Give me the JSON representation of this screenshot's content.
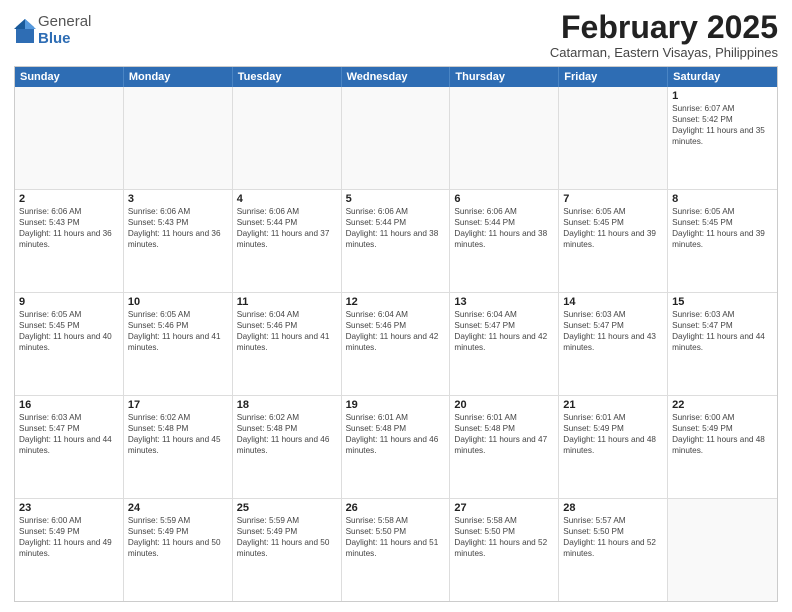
{
  "header": {
    "logo": {
      "general": "General",
      "blue": "Blue"
    },
    "title": "February 2025",
    "subtitle": "Catarman, Eastern Visayas, Philippines"
  },
  "calendar": {
    "days_of_week": [
      "Sunday",
      "Monday",
      "Tuesday",
      "Wednesday",
      "Thursday",
      "Friday",
      "Saturday"
    ],
    "weeks": [
      [
        {
          "day": "",
          "empty": true
        },
        {
          "day": "",
          "empty": true
        },
        {
          "day": "",
          "empty": true
        },
        {
          "day": "",
          "empty": true
        },
        {
          "day": "",
          "empty": true
        },
        {
          "day": "",
          "empty": true
        },
        {
          "day": "1",
          "sunrise": "6:07 AM",
          "sunset": "5:42 PM",
          "daylight": "11 hours and 35 minutes."
        }
      ],
      [
        {
          "day": "2",
          "sunrise": "6:06 AM",
          "sunset": "5:43 PM",
          "daylight": "11 hours and 36 minutes."
        },
        {
          "day": "3",
          "sunrise": "6:06 AM",
          "sunset": "5:43 PM",
          "daylight": "11 hours and 36 minutes."
        },
        {
          "day": "4",
          "sunrise": "6:06 AM",
          "sunset": "5:44 PM",
          "daylight": "11 hours and 37 minutes."
        },
        {
          "day": "5",
          "sunrise": "6:06 AM",
          "sunset": "5:44 PM",
          "daylight": "11 hours and 38 minutes."
        },
        {
          "day": "6",
          "sunrise": "6:06 AM",
          "sunset": "5:44 PM",
          "daylight": "11 hours and 38 minutes."
        },
        {
          "day": "7",
          "sunrise": "6:05 AM",
          "sunset": "5:45 PM",
          "daylight": "11 hours and 39 minutes."
        },
        {
          "day": "8",
          "sunrise": "6:05 AM",
          "sunset": "5:45 PM",
          "daylight": "11 hours and 39 minutes."
        }
      ],
      [
        {
          "day": "9",
          "sunrise": "6:05 AM",
          "sunset": "5:45 PM",
          "daylight": "11 hours and 40 minutes."
        },
        {
          "day": "10",
          "sunrise": "6:05 AM",
          "sunset": "5:46 PM",
          "daylight": "11 hours and 41 minutes."
        },
        {
          "day": "11",
          "sunrise": "6:04 AM",
          "sunset": "5:46 PM",
          "daylight": "11 hours and 41 minutes."
        },
        {
          "day": "12",
          "sunrise": "6:04 AM",
          "sunset": "5:46 PM",
          "daylight": "11 hours and 42 minutes."
        },
        {
          "day": "13",
          "sunrise": "6:04 AM",
          "sunset": "5:47 PM",
          "daylight": "11 hours and 42 minutes."
        },
        {
          "day": "14",
          "sunrise": "6:03 AM",
          "sunset": "5:47 PM",
          "daylight": "11 hours and 43 minutes."
        },
        {
          "day": "15",
          "sunrise": "6:03 AM",
          "sunset": "5:47 PM",
          "daylight": "11 hours and 44 minutes."
        }
      ],
      [
        {
          "day": "16",
          "sunrise": "6:03 AM",
          "sunset": "5:47 PM",
          "daylight": "11 hours and 44 minutes."
        },
        {
          "day": "17",
          "sunrise": "6:02 AM",
          "sunset": "5:48 PM",
          "daylight": "11 hours and 45 minutes."
        },
        {
          "day": "18",
          "sunrise": "6:02 AM",
          "sunset": "5:48 PM",
          "daylight": "11 hours and 46 minutes."
        },
        {
          "day": "19",
          "sunrise": "6:01 AM",
          "sunset": "5:48 PM",
          "daylight": "11 hours and 46 minutes."
        },
        {
          "day": "20",
          "sunrise": "6:01 AM",
          "sunset": "5:48 PM",
          "daylight": "11 hours and 47 minutes."
        },
        {
          "day": "21",
          "sunrise": "6:01 AM",
          "sunset": "5:49 PM",
          "daylight": "11 hours and 48 minutes."
        },
        {
          "day": "22",
          "sunrise": "6:00 AM",
          "sunset": "5:49 PM",
          "daylight": "11 hours and 48 minutes."
        }
      ],
      [
        {
          "day": "23",
          "sunrise": "6:00 AM",
          "sunset": "5:49 PM",
          "daylight": "11 hours and 49 minutes."
        },
        {
          "day": "24",
          "sunrise": "5:59 AM",
          "sunset": "5:49 PM",
          "daylight": "11 hours and 50 minutes."
        },
        {
          "day": "25",
          "sunrise": "5:59 AM",
          "sunset": "5:49 PM",
          "daylight": "11 hours and 50 minutes."
        },
        {
          "day": "26",
          "sunrise": "5:58 AM",
          "sunset": "5:50 PM",
          "daylight": "11 hours and 51 minutes."
        },
        {
          "day": "27",
          "sunrise": "5:58 AM",
          "sunset": "5:50 PM",
          "daylight": "11 hours and 52 minutes."
        },
        {
          "day": "28",
          "sunrise": "5:57 AM",
          "sunset": "5:50 PM",
          "daylight": "11 hours and 52 minutes."
        },
        {
          "day": "",
          "empty": true
        }
      ]
    ]
  }
}
